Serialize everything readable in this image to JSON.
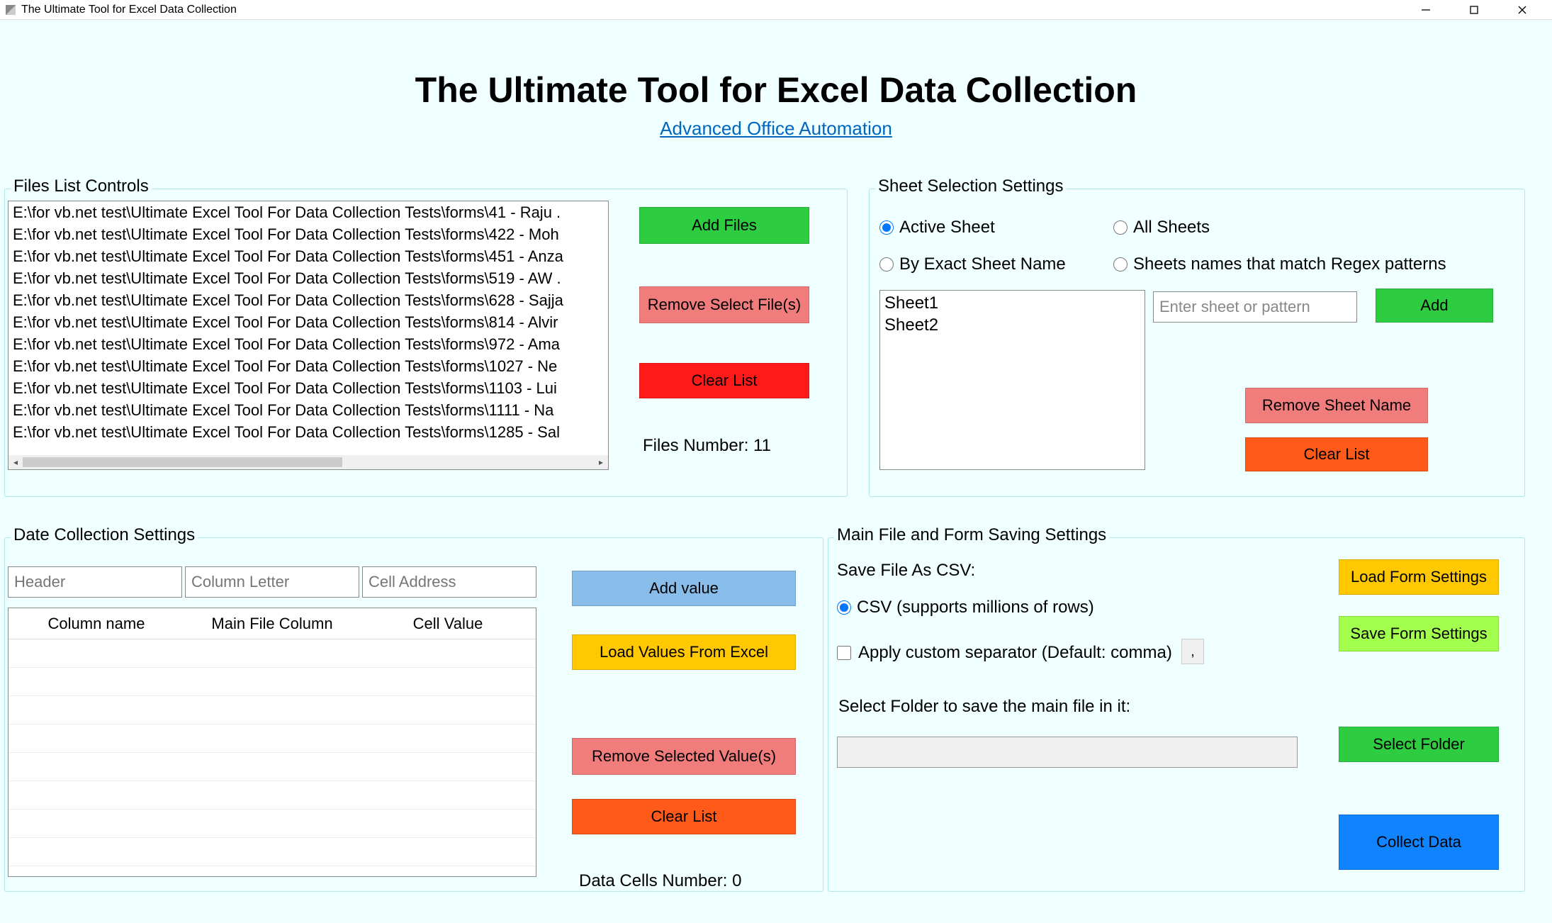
{
  "window_title": "The Ultimate Tool for Excel Data Collection",
  "header": {
    "title": "The Ultimate Tool for Excel Data Collection",
    "link": "Advanced Office Automation"
  },
  "files_group": {
    "legend": "Files List Controls",
    "items": [
      "E:\\for vb.net test\\Ultimate Excel Tool For Data Collection Tests\\forms\\41 - Raju .",
      "E:\\for vb.net test\\Ultimate Excel Tool For Data Collection Tests\\forms\\422 - Moh",
      "E:\\for vb.net test\\Ultimate Excel Tool For Data Collection Tests\\forms\\451 - Anza",
      "E:\\for vb.net test\\Ultimate Excel Tool For Data Collection Tests\\forms\\519 - AW .",
      "E:\\for vb.net test\\Ultimate Excel Tool For Data Collection Tests\\forms\\628 - Sajja",
      "E:\\for vb.net test\\Ultimate Excel Tool For Data Collection Tests\\forms\\814 - Alvir",
      "E:\\for vb.net test\\Ultimate Excel Tool For Data Collection Tests\\forms\\972 - Ama",
      "E:\\for vb.net test\\Ultimate Excel Tool For Data Collection Tests\\forms\\1027 - Ne",
      "E:\\for vb.net test\\Ultimate Excel Tool For Data Collection Tests\\forms\\1103 - Lui",
      "E:\\for vb.net test\\Ultimate Excel Tool For Data Collection Tests\\forms\\1111 - Na",
      "E:\\for vb.net test\\Ultimate Excel Tool For Data Collection Tests\\forms\\1285 - Sal"
    ],
    "add_label": "Add Files",
    "remove_label": "Remove Select File(s)",
    "clear_label": "Clear List",
    "count_label": "Files Number: 11"
  },
  "sheets_group": {
    "legend": "Sheet Selection Settings",
    "r_active": "Active Sheet",
    "r_all": "All Sheets",
    "r_exact": "By Exact Sheet Name",
    "r_regex": "Sheets names that match Regex patterns",
    "sheets": [
      "Sheet1",
      "Sheet2"
    ],
    "pattern_placeholder": "Enter sheet or pattern",
    "add_label": "Add",
    "remove_label": "Remove Sheet Name",
    "clear_label": "Clear List"
  },
  "datacoll_group": {
    "legend": "Date Collection Settings",
    "ph_header": "Header",
    "ph_colletter": "Column Letter",
    "ph_celladdr": "Cell Address",
    "th_col": "Column name",
    "th_main": "Main File Column",
    "th_cell": "Cell Value",
    "addvalue_label": "Add value",
    "loadexcel_label": "Load Values From Excel",
    "removeval_label": "Remove Selected Value(s)",
    "clearvals_label": "Clear List",
    "cellcount_label": "Data Cells Number: 0"
  },
  "mainfile_group": {
    "legend": "Main File and Form Saving Settings",
    "savecsv_label": "Save File As CSV:",
    "r_csv": "CSV (supports millions of rows)",
    "chk_sep_label": "Apply custom separator (Default: comma)",
    "sep_value": ",",
    "selectfolder_label": "Select Folder to save the main file in it:",
    "loadform_label": "Load Form Settings",
    "saveform_label": "Save Form Settings",
    "selectfolder_btn": "Select Folder",
    "collect_label": "Collect Data"
  }
}
